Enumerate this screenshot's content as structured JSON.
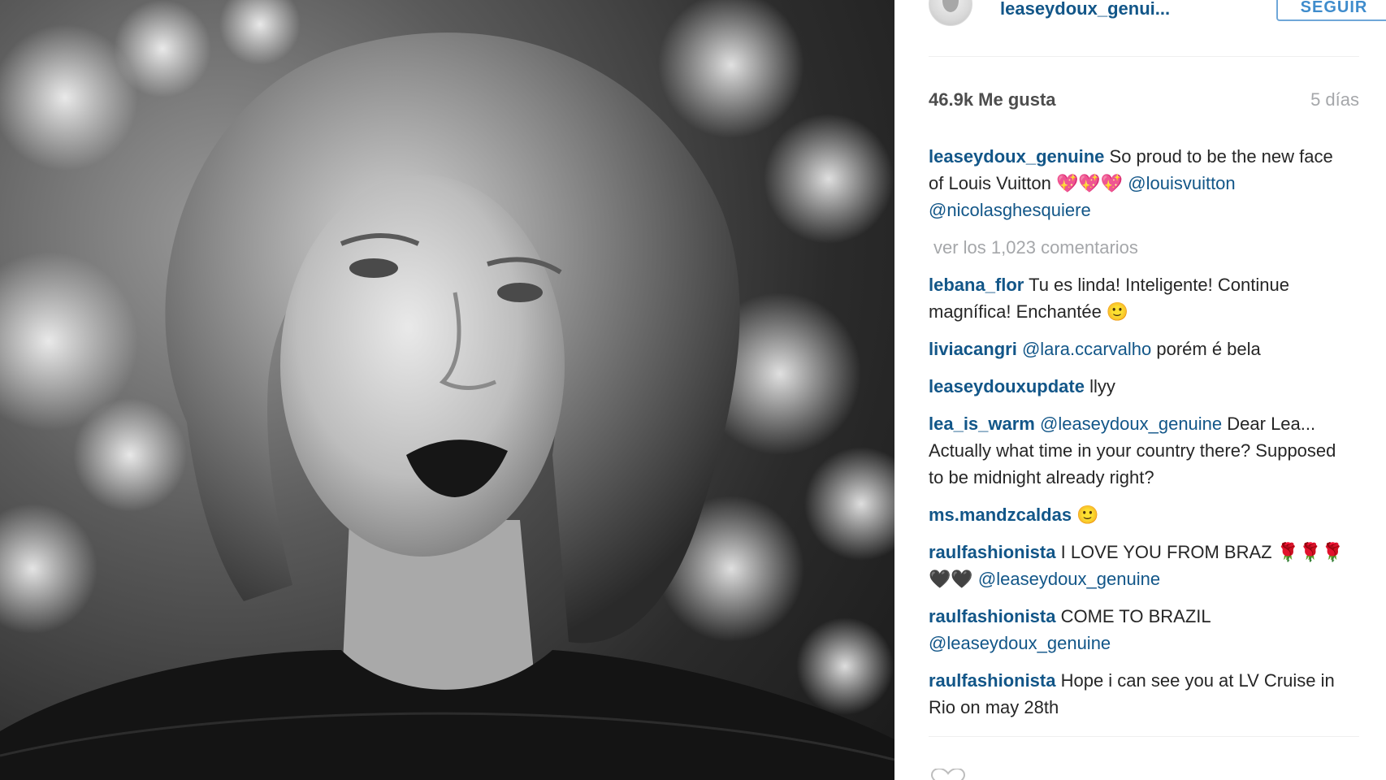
{
  "post": {
    "username": "leaseydoux_genui...",
    "follow_label": "SEGUIR",
    "likes": "46.9k Me gusta",
    "time": "5 días"
  },
  "caption": {
    "user": "leaseydoux_genuine",
    "text": " So proud to be the new face of Louis Vuitton 💖💖💖 ",
    "mention1": "@louisvuitton",
    "mention2": " @nicolasghesquiere"
  },
  "view_all": "ver los 1,023 comentarios",
  "comments": [
    {
      "user": "lebana_flor",
      "text": " Tu es linda! Inteligente! Continue magnífica! Enchantée 🙂"
    },
    {
      "user": "liviacangri",
      "mention": " @lara.ccarvalho",
      "text": " porém é bela"
    },
    {
      "user": "leaseydouxupdate",
      "text": " llyy"
    },
    {
      "user": "lea_is_warm",
      "mention": " @leaseydoux_genuine",
      "text": " Dear Lea... Actually what time in your country there? Supposed to be midnight already right?"
    },
    {
      "user": "ms.mandzcaldas",
      "text": " 🙂"
    },
    {
      "user": "raulfashionista",
      "text": " I LOVE YOU FROM BRAZ 🌹🌹🌹🖤🖤 ",
      "mention": "@leaseydoux_genuine"
    },
    {
      "user": "raulfashionista",
      "text": " COME TO BRAZIL ",
      "mention": "@leaseydoux_genuine"
    },
    {
      "user": "raulfashionista",
      "text": " Hope i can see you at LV Cruise in Rio on may 28th"
    }
  ],
  "icons": {
    "heart": "heart-icon",
    "avatar": "avatar"
  },
  "colors": {
    "link": "#125688",
    "follow": "#3f8ccc",
    "muted": "#a5a7aa"
  }
}
